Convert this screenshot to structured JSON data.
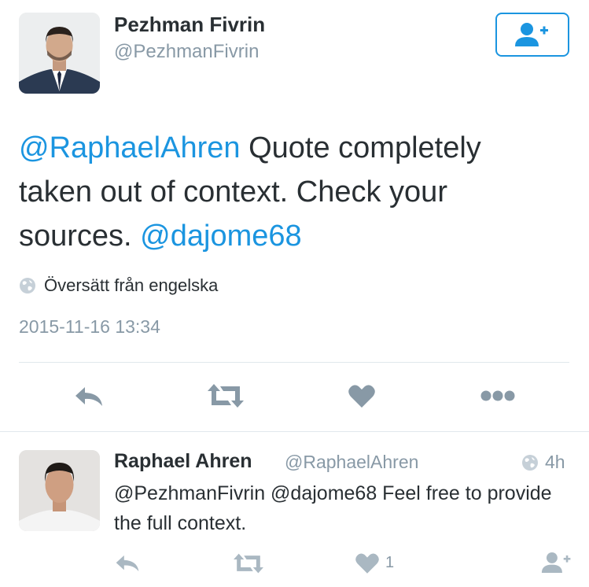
{
  "tweet": {
    "author_name": "Pezhman Fivrin",
    "author_handle": "@PezhmanFivrin",
    "text_segments": [
      {
        "text": "@RaphaelAhren",
        "type": "mention"
      },
      {
        "text": " Quote completely taken out of context. Check your sources. ",
        "type": "text"
      },
      {
        "text": "@dajome68",
        "type": "mention"
      }
    ],
    "translate_label": "Översätt från engelska",
    "timestamp": "2015-11-16 13:34",
    "actions": [
      "reply-icon",
      "retweet-icon",
      "heart-icon",
      "more-icon"
    ]
  },
  "follow_button": {
    "icon": "add-user-icon"
  },
  "reply": {
    "author_name": "Raphael Ahren",
    "author_handle": "@RaphaelAhren",
    "time": "4h",
    "text": "@PezhmanFivrin @dajome68 Feel free to provide the full context.",
    "like_count": "1",
    "actions": [
      "reply-icon",
      "retweet-icon",
      "heart-icon",
      "add-user-icon"
    ]
  },
  "colors": {
    "accent": "#1b95e0",
    "muted": "#8899a6",
    "text": "#292f33",
    "divider": "#e1e8ed"
  }
}
